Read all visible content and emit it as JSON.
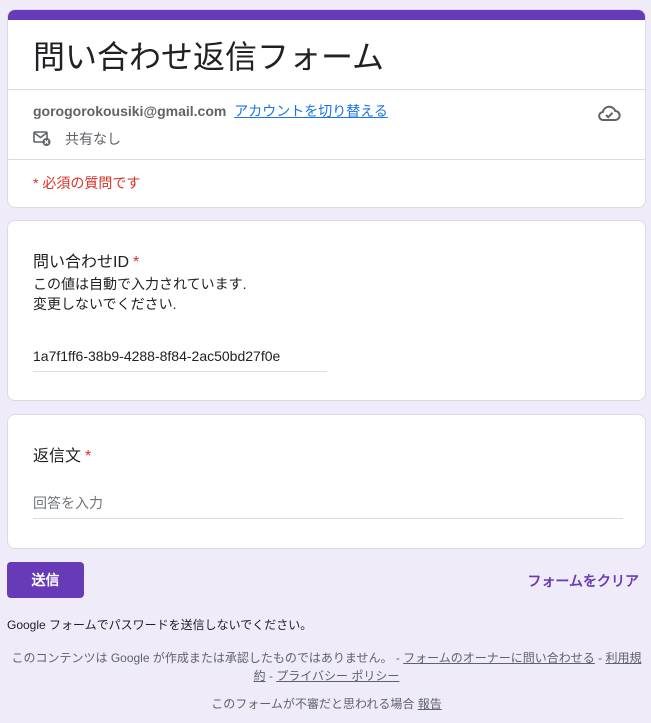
{
  "header": {
    "title": "問い合わせ返信フォーム",
    "email": "gorogorokousiki@gmail.com",
    "switch_account": "アカウントを切り替える",
    "share_status": "共有なし",
    "required_note": "* 必須の質問です",
    "cloud_icon": "cloud-saved-icon",
    "share_icon": "mail-not-shared-icon"
  },
  "questions": [
    {
      "title": "問い合わせID",
      "required_mark": "*",
      "description_line1": "この値は自動で入力されています.",
      "description_line2": "変更しないでください.",
      "value": "1a7f1ff6-38b9-4288-8f84-2ac50bd27f0e"
    },
    {
      "title": "返信文",
      "required_mark": "*",
      "placeholder": "回答を入力"
    }
  ],
  "actions": {
    "submit": "送信",
    "clear": "フォームをクリア"
  },
  "footer": {
    "password_warning": "Google フォームでパスワードを送信しないでください。",
    "disclaimer": "このコンテンツは Google が作成または承認したものではありません。 - ",
    "contact_owner": "フォームのオーナーに問い合わせる",
    "sep1": " - ",
    "terms": "利用規約",
    "sep2": " - ",
    "privacy": "プライバシー ポリシー",
    "report_prefix": "このフォームが不審だと思われる場合 ",
    "report_link": "報告"
  },
  "colors": {
    "accent": "#673ab7",
    "background": "#f0ebf8",
    "required": "#d93025",
    "link": "#1a73e8"
  }
}
